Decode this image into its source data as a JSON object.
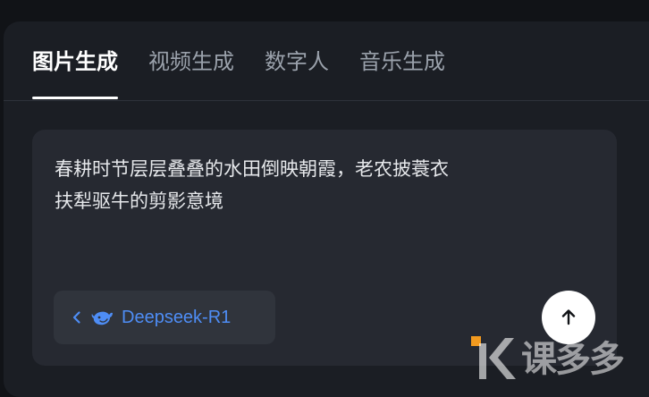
{
  "tabs": [
    {
      "label": "图片生成",
      "active": true
    },
    {
      "label": "视频生成",
      "active": false
    },
    {
      "label": "数字人",
      "active": false
    },
    {
      "label": "音乐生成",
      "active": false
    }
  ],
  "prompt": {
    "text_line1": "春耕时节层层叠叠的水田倒映朝霞，老农披蓑衣",
    "text_line2": "扶犁驱牛的剪影意境"
  },
  "model_selector": {
    "label": "Deepseek-R1",
    "icon": "deepseek-whale-icon",
    "color": "#4e8df5"
  },
  "send_button": {
    "icon": "arrow-up-icon"
  },
  "watermark": {
    "text": "课多多",
    "accent": "#f29a1f"
  }
}
